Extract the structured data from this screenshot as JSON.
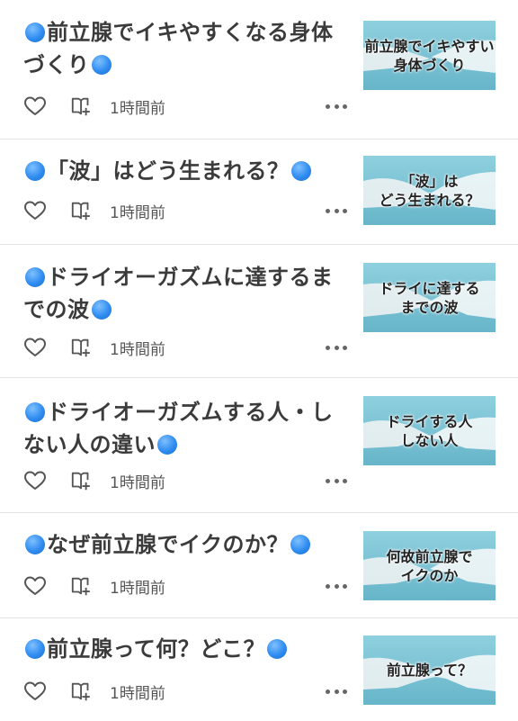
{
  "articles": [
    {
      "title": "前立腺でイキやすくなる身体づくり",
      "time": "1時間前",
      "thumbnail_text": "前立腺でイキやすい\n身体づくり",
      "like_icon": "heart-outline-icon",
      "magazine_icon": "add-to-magazine-icon",
      "more_icon": "more-dots-icon"
    },
    {
      "title": "「波」はどう生まれる？",
      "time": "1時間前",
      "thumbnail_text": "「波」は\nどう生まれる？",
      "like_icon": "heart-outline-icon",
      "magazine_icon": "add-to-magazine-icon",
      "more_icon": "more-dots-icon"
    },
    {
      "title": "ドライオーガズムに達するまでの波",
      "time": "1時間前",
      "thumbnail_text": "ドライに達する\nまでの波",
      "like_icon": "heart-outline-icon",
      "magazine_icon": "add-to-magazine-icon",
      "more_icon": "more-dots-icon"
    },
    {
      "title": "ドライオーガズムする人・しない人の違い",
      "time": "1時間前",
      "thumbnail_text": "ドライする人\nしない人",
      "like_icon": "heart-outline-icon",
      "magazine_icon": "add-to-magazine-icon",
      "more_icon": "more-dots-icon"
    },
    {
      "title": "なぜ前立腺でイクのか？",
      "time": "1時間前",
      "thumbnail_text": "何故前立腺で\nイクのか",
      "like_icon": "heart-outline-icon",
      "magazine_icon": "add-to-magazine-icon",
      "more_icon": "more-dots-icon"
    },
    {
      "title": "前立腺って何？どこ？",
      "time": "1時間前",
      "thumbnail_text": "前立腺って？",
      "like_icon": "heart-outline-icon",
      "magazine_icon": "add-to-magazine-icon",
      "more_icon": "more-dots-icon"
    }
  ],
  "colors": {
    "title_dot": "#2f8cf0",
    "thumbnail_background": "#7cc3d4",
    "divider": "#e4e4e4"
  }
}
